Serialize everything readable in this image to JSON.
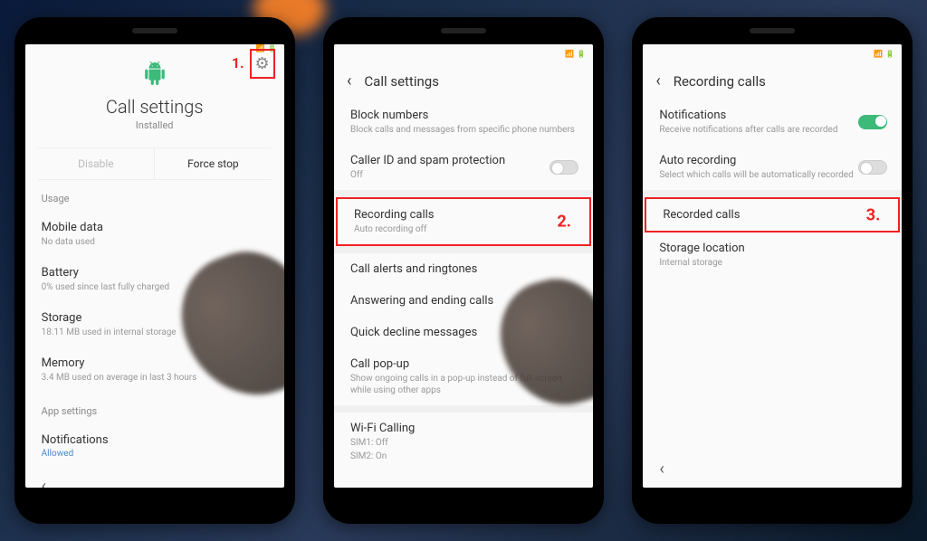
{
  "annotations": {
    "step1": "1.",
    "step2": "2.",
    "step3": "3."
  },
  "phone1": {
    "title": "Call settings",
    "subtitle": "Installed",
    "disable_btn": "Disable",
    "forcestop_btn": "Force stop",
    "section_usage": "Usage",
    "mobile_data": {
      "title": "Mobile data",
      "sub": "No data used"
    },
    "battery": {
      "title": "Battery",
      "sub": "0% used since last fully charged"
    },
    "storage": {
      "title": "Storage",
      "sub": "18.11 MB used in internal storage"
    },
    "memory": {
      "title": "Memory",
      "sub": "3.4 MB used on average in last 3 hours"
    },
    "section_app": "App settings",
    "notifications": {
      "title": "Notifications",
      "sub": "Allowed"
    }
  },
  "phone2": {
    "header": "Call settings",
    "block": {
      "title": "Block numbers",
      "sub": "Block calls and messages from specific phone numbers"
    },
    "caller_id": {
      "title": "Caller ID and spam protection",
      "sub": "Off"
    },
    "recording": {
      "title": "Recording calls",
      "sub": "Auto recording off"
    },
    "alerts": "Call alerts and ringtones",
    "answering": "Answering and ending calls",
    "decline": "Quick decline messages",
    "popup": {
      "title": "Call pop-up",
      "sub": "Show ongoing calls in a pop-up instead of full screen while using other apps"
    },
    "wifi": {
      "title": "Wi-Fi Calling",
      "sub1": "SIM1: Off",
      "sub2": "SIM2: On"
    }
  },
  "phone3": {
    "header": "Recording calls",
    "notifications": {
      "title": "Notifications",
      "sub": "Receive notifications after calls are recorded"
    },
    "auto": {
      "title": "Auto recording",
      "sub": "Select which calls will be automatically recorded"
    },
    "recorded": "Recorded calls",
    "storage": {
      "title": "Storage location",
      "sub": "Internal storage"
    }
  }
}
